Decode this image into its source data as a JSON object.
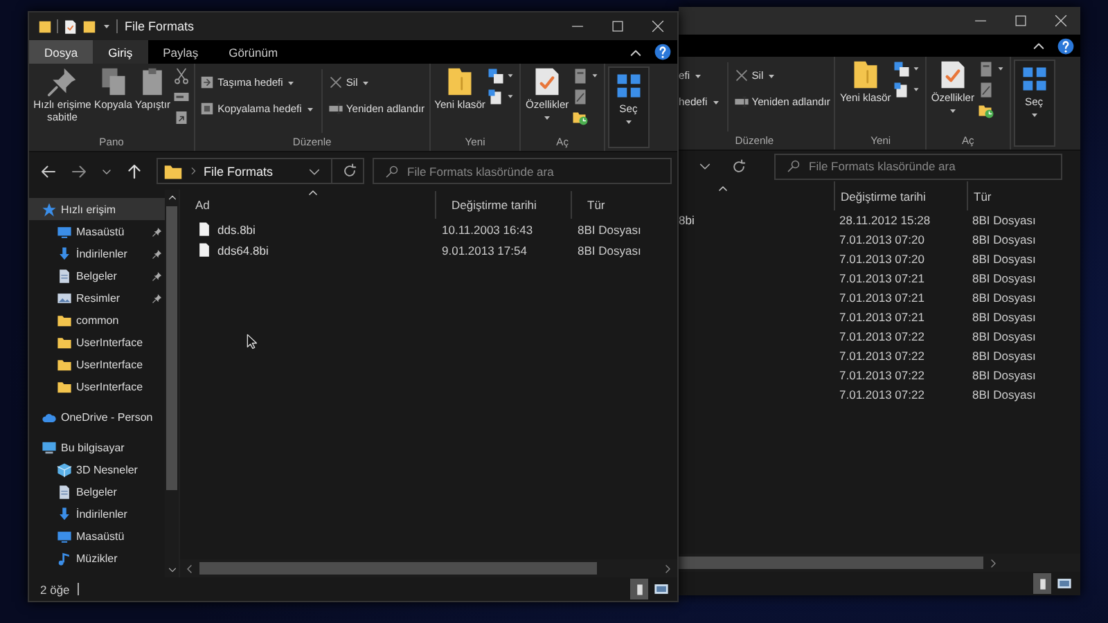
{
  "back_window": {
    "ribbon": [
      {
        "label": "Düzenle",
        "kind": "plain",
        "columns": [
          {
            "kind": "stack",
            "entries": [
              {
                "label": "efi"
              },
              {
                "label": "hedefi"
              }
            ]
          },
          {
            "kind": "divider"
          },
          {
            "kind": "stack",
            "entries": [
              {
                "label": "Sil"
              },
              {
                "label": "Yeniden adlandır"
              }
            ]
          }
        ]
      },
      {
        "label": "Yeni",
        "kind": "plain",
        "columns": [
          {
            "kind": "large",
            "label": "Yeni klasör"
          },
          {
            "kind": "icons"
          }
        ]
      },
      {
        "label": "Aç",
        "kind": "plain",
        "columns": [
          {
            "kind": "large",
            "label": "Özellikler"
          },
          {
            "kind": "icons"
          }
        ]
      },
      {
        "kind": "boxed",
        "columns": [
          {
            "kind": "large",
            "label": "Seç"
          }
        ]
      }
    ],
    "search": {
      "placeholder": "File Formats klasöründe ara"
    },
    "columns": [
      "Değiştirme tarihi",
      "Tür"
    ],
    "rows": [
      {
        "name": "8bi",
        "date": "28.11.2012 15:28",
        "type": "8BI Dosyası"
      },
      {
        "date": "7.01.2013 07:20",
        "type": "8BI Dosyası"
      },
      {
        "date": "7.01.2013 07:20",
        "type": "8BI Dosyası"
      },
      {
        "date": "7.01.2013 07:21",
        "type": "8BI Dosyası"
      },
      {
        "date": "7.01.2013 07:21",
        "type": "8BI Dosyası"
      },
      {
        "date": "7.01.2013 07:21",
        "type": "8BI Dosyası"
      },
      {
        "date": "7.01.2013 07:22",
        "type": "8BI Dosyası"
      },
      {
        "date": "7.01.2013 07:22",
        "type": "8BI Dosyası"
      },
      {
        "date": "7.01.2013 07:22",
        "type": "8BI Dosyası"
      },
      {
        "date": "7.01.2013 07:22",
        "type": "8BI Dosyası"
      }
    ]
  },
  "front_window": {
    "title": "File Formats",
    "tabs": [
      {
        "label": "Dosya",
        "kind": "file",
        "selected": false
      },
      {
        "label": "Giriş",
        "kind": "tab",
        "selected": true
      },
      {
        "label": "Paylaş",
        "kind": "tab",
        "selected": false
      },
      {
        "label": "Görünüm",
        "kind": "tab",
        "selected": false
      }
    ],
    "ribbon": [
      {
        "label": "Pano",
        "kind": "plain",
        "columns": [
          {
            "kind": "large",
            "label": "Hızlı erişime sabitle"
          },
          {
            "kind": "large",
            "label": "Kopyala"
          },
          {
            "kind": "large",
            "label": "Yapıştır"
          },
          {
            "kind": "icons"
          }
        ]
      },
      {
        "label": "Düzenle",
        "kind": "plain",
        "columns": [
          {
            "kind": "stack",
            "entries": [
              {
                "label": "Taşıma hedefi"
              },
              {
                "label": "Kopyalama hedefi"
              }
            ]
          },
          {
            "kind": "divider"
          },
          {
            "kind": "stack",
            "entries": [
              {
                "label": "Sil"
              },
              {
                "label": "Yeniden adlandır"
              }
            ]
          }
        ]
      },
      {
        "label": "Yeni",
        "kind": "plain",
        "columns": [
          {
            "kind": "large",
            "label": "Yeni klasör"
          },
          {
            "kind": "icons"
          }
        ]
      },
      {
        "label": "Aç",
        "kind": "plain",
        "columns": [
          {
            "kind": "large",
            "label": "Özellikler"
          },
          {
            "kind": "icons"
          }
        ]
      },
      {
        "kind": "boxed",
        "columns": [
          {
            "kind": "large",
            "label": "Seç"
          }
        ]
      }
    ],
    "address": "File Formats",
    "search": {
      "placeholder": "File Formats klasöründe ara"
    },
    "sidebar": [
      {
        "label": "Hızlı erişim",
        "selected": true,
        "children": [
          {
            "label": "Masaüstü",
            "pinned": true,
            "selected": false
          },
          {
            "label": "İndirilenler",
            "pinned": true,
            "selected": false
          },
          {
            "label": "Belgeler",
            "pinned": true,
            "selected": false
          },
          {
            "label": "Resimler",
            "pinned": true,
            "selected": false
          },
          {
            "label": "common",
            "pinned": false,
            "selected": false
          },
          {
            "label": "UserInterface",
            "pinned": false,
            "selected": false
          },
          {
            "label": "UserInterface",
            "pinned": false,
            "selected": false
          },
          {
            "label": "UserInterface",
            "pinned": false,
            "selected": false
          }
        ]
      },
      {
        "label": "OneDrive - Person",
        "selected": false
      },
      {
        "label": "Bu bilgisayar",
        "selected": false,
        "children": [
          {
            "label": "3D Nesneler",
            "pinned": false,
            "selected": false
          },
          {
            "label": "Belgeler",
            "pinned": false,
            "selected": false
          },
          {
            "label": "İndirilenler",
            "pinned": false,
            "selected": false
          },
          {
            "label": "Masaüstü",
            "pinned": false,
            "selected": false
          },
          {
            "label": "Müzikler",
            "pinned": false,
            "selected": false
          }
        ]
      }
    ],
    "columns": [
      "Ad",
      "Değiştirme tarihi",
      "Tür"
    ],
    "rows": [
      {
        "name": "dds.8bi",
        "date": "10.11.2003 16:43",
        "type": "8BI Dosyası"
      },
      {
        "name": "dds64.8bi",
        "date": "9.01.2013 17:54",
        "type": "8BI Dosyası"
      }
    ],
    "status": "2 öğe"
  }
}
